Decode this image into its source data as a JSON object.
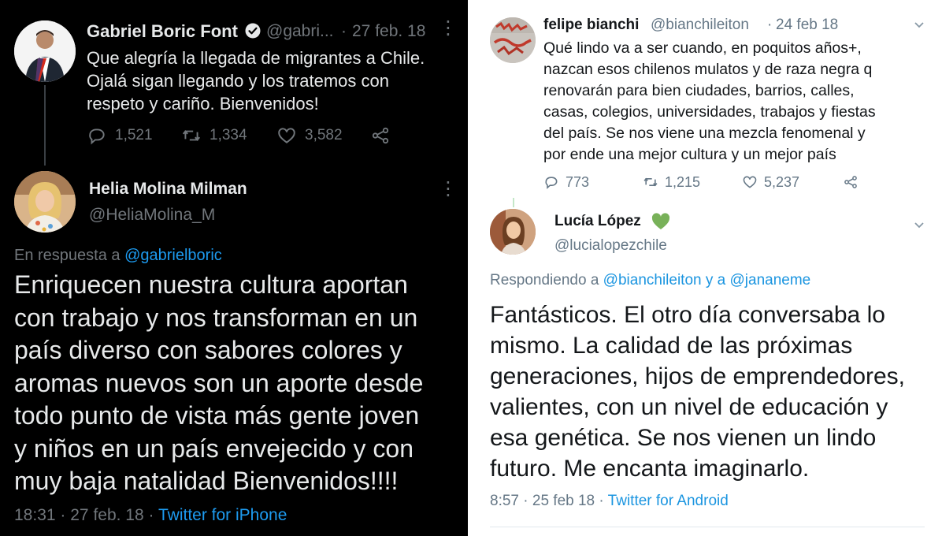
{
  "left_panel": {
    "colors": {
      "background": "#000000",
      "text": "#e7e9ea",
      "muted": "#71767b",
      "link": "#1d9bf0"
    },
    "parent_tweet": {
      "name": "Gabriel Boric Font",
      "verified_icon": "verified-badge-icon",
      "handle": "@gabri...",
      "separator": "·",
      "date": "27 feb. 18",
      "more_icon": "more-vertical-icon",
      "text": "Que alegría la llegada de migrantes a Chile.\nOjalá sigan llegando y los tratemos con\nrespeto y cariño. Bienvenidos!",
      "actions": [
        {
          "icon": "reply-icon",
          "count": "1,521"
        },
        {
          "icon": "retweet-icon",
          "count": "1,334"
        },
        {
          "icon": "like-icon",
          "count": "3,582"
        },
        {
          "icon": "share-icon",
          "count": ""
        }
      ]
    },
    "reply_tweet": {
      "name": "Helia Molina Milman",
      "handle": "@HeliaMolina_M",
      "more_icon": "more-vertical-icon",
      "reply_prefix": "En respuesta a ",
      "reply_to": "@gabrielboric",
      "text": "Enriquecen nuestra cultura aportan\ncon trabajo y nos transforman en un\npaís diverso con sabores colores y\naromas nuevos son un aporte desde\ntodo punto de vista más gente joven\ny niños en un país envejecido y con\nmuy baja natalidad Bienvenidos!!!!",
      "time": "18:31",
      "separator": "·",
      "date": "27 feb. 18",
      "separator2": "·",
      "source": "Twitter for iPhone"
    }
  },
  "right_panel": {
    "colors": {
      "background": "#ffffff",
      "text": "#14171a",
      "muted": "#657786",
      "link": "#1b95e0",
      "heart": "#78b159"
    },
    "parent_tweet": {
      "name": "felipe bianchi",
      "handle": "@bianchileiton",
      "separator": "·",
      "date": "24 feb 18",
      "chevron_icon": "chevron-down-icon",
      "text": "Qué lindo va a ser cuando, en poquitos años+,\nnazcan esos chilenos mulatos y de raza negra q\nrenovarán para bien ciudades, barrios, calles,\ncasas, colegios, universidades, trabajos y fiestas\ndel país. Se nos viene una mezcla fenomenal y\npor ende una mejor cultura y un mejor país",
      "actions": [
        {
          "icon": "reply-icon",
          "count": "773"
        },
        {
          "icon": "retweet-icon",
          "count": "1,215"
        },
        {
          "icon": "like-icon",
          "count": "5,237"
        },
        {
          "icon": "share-icon",
          "count": ""
        }
      ]
    },
    "reply_tweet": {
      "name": "Lucía López",
      "name_emoji_icon": "green-heart-icon",
      "handle": "@lucialopezchile",
      "chevron_icon": "chevron-down-icon",
      "reply_prefix": "Respondiendo a ",
      "reply_to_1": "@bianchileiton",
      "reply_joiner": " y a ",
      "reply_to_2": "@jananeme",
      "text": "Fantásticos. El otro día conversaba lo\nmismo. La calidad de las próximas\ngeneraciones, hijos de emprendedores,\nvalientes, con un nivel de educación y\nesa genética. Se nos vienen un lindo\nfuturo. Me encanta imaginarlo.",
      "time": "8:57",
      "separator": "·",
      "date": "25 feb 18",
      "separator2": "·",
      "source": "Twitter for Android"
    }
  }
}
